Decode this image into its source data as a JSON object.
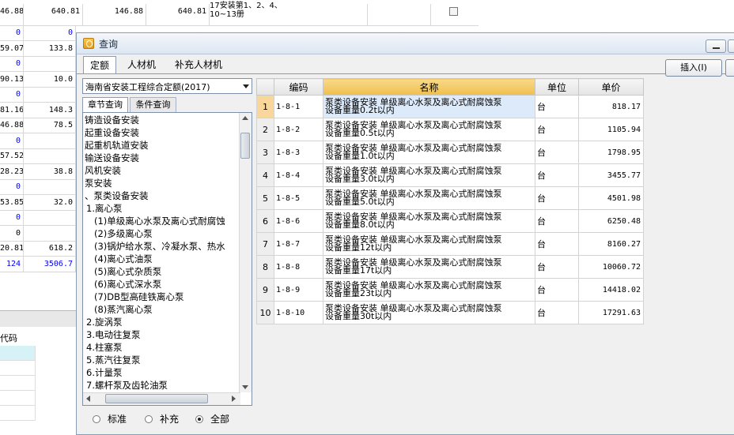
{
  "background": {
    "top_row": {
      "c1": "46.88",
      "c2": "640.81",
      "c3": "146.88",
      "c4": "640.81",
      "desc": "17安装第1、2、4、10~13册"
    },
    "rows": [
      {
        "a": "0",
        "b": "0",
        "blue": true
      },
      {
        "a": "59.07",
        "b": "133.8",
        "blue": false
      },
      {
        "a": "0",
        "b": "",
        "blue": true
      },
      {
        "a": "90.13",
        "b": "10.0",
        "blue": false
      },
      {
        "a": "0",
        "b": "",
        "blue": true
      },
      {
        "a": "81.16",
        "b": "148.3",
        "blue": false
      },
      {
        "a": "46.88",
        "b": "78.5",
        "blue": false
      },
      {
        "a": "0",
        "b": "",
        "blue": true
      },
      {
        "a": "57.52",
        "b": "",
        "blue": false
      },
      {
        "a": "28.23",
        "b": "38.8",
        "blue": false
      },
      {
        "a": "0",
        "b": "",
        "blue": true
      },
      {
        "a": "53.85",
        "b": "32.0",
        "blue": false
      },
      {
        "a": "0",
        "b": "",
        "blue": true
      },
      {
        "a": "0",
        "b": "",
        "blue": false
      },
      {
        "a": "20.81",
        "b": "618.2",
        "blue": false
      },
      {
        "a": "124",
        "b": "3506.7",
        "blue": true
      }
    ],
    "bottom_header": "代码"
  },
  "dialog": {
    "title": "查询",
    "tabs": [
      "定额",
      "人材机",
      "补充人材机"
    ],
    "insert_label": "插入(I)",
    "quota_select": "海南省安装工程综合定额(2017)",
    "sub_tabs": [
      "章节查询",
      "条件查询"
    ],
    "tree": [
      "铸造设备安装",
      "起重设备安装",
      "起重机轨道安装",
      "输送设备安装",
      "风机安装",
      "泵安装",
      "、泵类设备安装",
      "1.离心泵",
      "(1)单级离心水泵及离心式耐腐蚀",
      "(2)多级离心泵",
      "(3)锅炉给水泵、冷凝水泵、热水",
      "(4)离心式油泵",
      "(5)离心式杂质泵",
      "(6)离心式深水泵",
      "(7)DB型高硅铁离心泵",
      "(8)蒸汽离心泵",
      "2.旋涡泵",
      "3.电动往复泵",
      "4.柱塞泵",
      "5.蒸汽往复泵",
      "6.计量泵",
      "7.螺杆泵及齿轮油泵"
    ],
    "radios": [
      {
        "label": "标准",
        "checked": false
      },
      {
        "label": "补充",
        "checked": false
      },
      {
        "label": "全部",
        "checked": true
      }
    ],
    "table": {
      "headers": [
        "",
        "编码",
        "名称",
        "单位",
        "单价"
      ],
      "rows": [
        {
          "n": "1",
          "code": "1-8-1",
          "name1": "泵类设备安装 单级离心水泵及离心式耐腐蚀泵",
          "name2": "设备重量0.2t以内",
          "unit": "台",
          "price": "818.17"
        },
        {
          "n": "2",
          "code": "1-8-2",
          "name1": "泵类设备安装 单级离心水泵及离心式耐腐蚀泵",
          "name2": "设备重量0.5t以内",
          "unit": "台",
          "price": "1105.94"
        },
        {
          "n": "3",
          "code": "1-8-3",
          "name1": "泵类设备安装 单级离心水泵及离心式耐腐蚀泵",
          "name2": "设备重量1.0t以内",
          "unit": "台",
          "price": "1798.95"
        },
        {
          "n": "4",
          "code": "1-8-4",
          "name1": "泵类设备安装 单级离心水泵及离心式耐腐蚀泵",
          "name2": "设备重量3.0t以内",
          "unit": "台",
          "price": "3455.77"
        },
        {
          "n": "5",
          "code": "1-8-5",
          "name1": "泵类设备安装 单级离心水泵及离心式耐腐蚀泵",
          "name2": "设备重量5.0t以内",
          "unit": "台",
          "price": "4501.98"
        },
        {
          "n": "6",
          "code": "1-8-6",
          "name1": "泵类设备安装 单级离心水泵及离心式耐腐蚀泵",
          "name2": "设备重量8.0t以内",
          "unit": "台",
          "price": "6250.48"
        },
        {
          "n": "7",
          "code": "1-8-7",
          "name1": "泵类设备安装 单级离心水泵及离心式耐腐蚀泵",
          "name2": "设备重量12t以内",
          "unit": "台",
          "price": "8160.27"
        },
        {
          "n": "8",
          "code": "1-8-8",
          "name1": "泵类设备安装 单级离心水泵及离心式耐腐蚀泵",
          "name2": "设备重量17t以内",
          "unit": "台",
          "price": "10060.72"
        },
        {
          "n": "9",
          "code": "1-8-9",
          "name1": "泵类设备安装 单级离心水泵及离心式耐腐蚀泵",
          "name2": "设备重量23t以内",
          "unit": "台",
          "price": "14418.02"
        },
        {
          "n": "10",
          "code": "1-8-10",
          "name1": "泵类设备安装 单级离心水泵及离心式耐腐蚀泵",
          "name2": "设备重量30t以内",
          "unit": "台",
          "price": "17291.63"
        }
      ]
    }
  }
}
